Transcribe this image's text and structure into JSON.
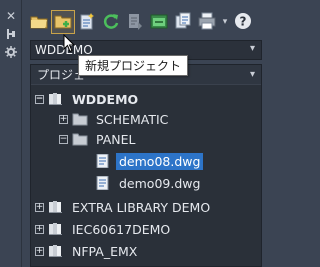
{
  "toolbar": {
    "buttons": [
      {
        "name": "open-project-icon"
      },
      {
        "name": "new-project-icon"
      },
      {
        "name": "new-drawing-icon"
      },
      {
        "name": "refresh-icon"
      },
      {
        "name": "task-list-icon"
      },
      {
        "name": "project-properties-icon"
      },
      {
        "name": "copy-project-icon"
      },
      {
        "name": "plot-icon"
      }
    ],
    "more_arrow": "▾"
  },
  "project_combo": {
    "value": "WDDEMO",
    "arrow": "▾"
  },
  "tooltip": {
    "text": "新規プロジェクト"
  },
  "tree": {
    "header": "プロジェ",
    "header_arrow": "▾",
    "rows": [
      {
        "label": "WDDEMO",
        "expander": "−",
        "bold": true,
        "icon": "project-book-icon"
      },
      {
        "label": "SCHEMATIC",
        "expander": "+",
        "bold": false,
        "icon": "folder-icon"
      },
      {
        "label": "PANEL",
        "expander": "−",
        "bold": false,
        "icon": "folder-icon"
      },
      {
        "label": "demo08.dwg",
        "expander": "",
        "bold": false,
        "icon": "drawing-icon",
        "selected": true
      },
      {
        "label": "demo09.dwg",
        "expander": "",
        "bold": false,
        "icon": "drawing-icon"
      },
      {
        "label": "EXTRA LIBRARY DEMO",
        "expander": "+",
        "bold": false,
        "icon": "project-book-icon"
      },
      {
        "label": "IEC60617DEMO",
        "expander": "+",
        "bold": false,
        "icon": "project-book-icon"
      },
      {
        "label": "NFPA_EMX",
        "expander": "+",
        "bold": false,
        "icon": "project-book-icon"
      }
    ]
  },
  "left_strip": {
    "icons": [
      "close-icon",
      "pin-icon",
      "settings-icon"
    ]
  }
}
